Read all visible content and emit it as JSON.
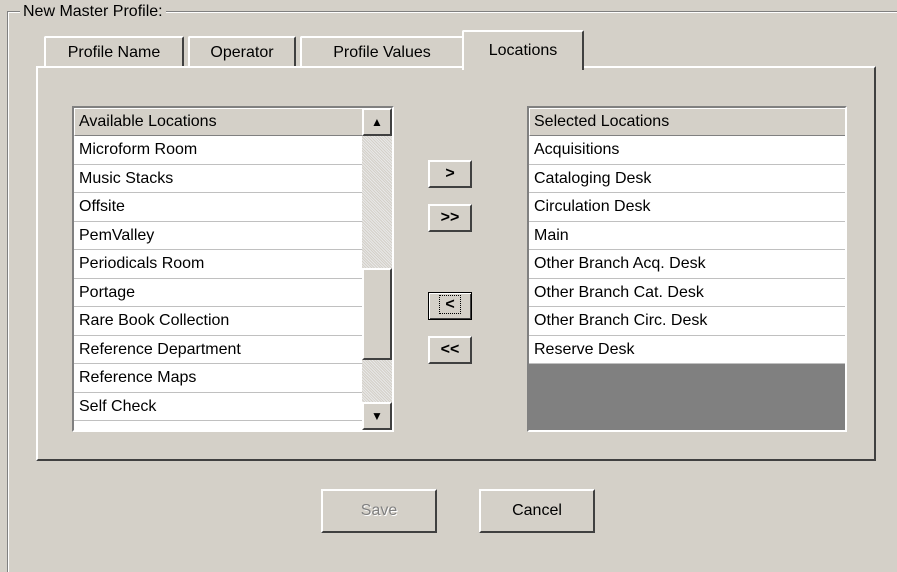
{
  "group_title": "New  Master Profile:",
  "tabs": [
    {
      "label": "Profile Name"
    },
    {
      "label": "Operator"
    },
    {
      "label": "Profile Values"
    },
    {
      "label": "Locations"
    }
  ],
  "available": {
    "header": "Available Locations",
    "items": [
      "Microform Room",
      "Music Stacks",
      "Offsite",
      "PemValley",
      "Periodicals Room",
      "Portage",
      "Rare Book Collection",
      "Reference Department",
      "Reference Maps",
      "Self Check"
    ]
  },
  "selected": {
    "header": "Selected Locations",
    "items": [
      "Acquisitions",
      "Cataloging Desk",
      "Circulation Desk",
      "Main",
      "Other Branch Acq. Desk",
      "Other Branch Cat. Desk",
      "Other Branch Circ. Desk",
      "Reserve Desk"
    ]
  },
  "transfer": {
    "add_one": ">",
    "add_all": ">>",
    "remove_one": "<",
    "remove_all": "<<"
  },
  "buttons": {
    "save": "Save",
    "cancel": "Cancel"
  },
  "icons": {
    "scroll_up": "arrow-up-icon",
    "scroll_down": "arrow-down-icon"
  }
}
